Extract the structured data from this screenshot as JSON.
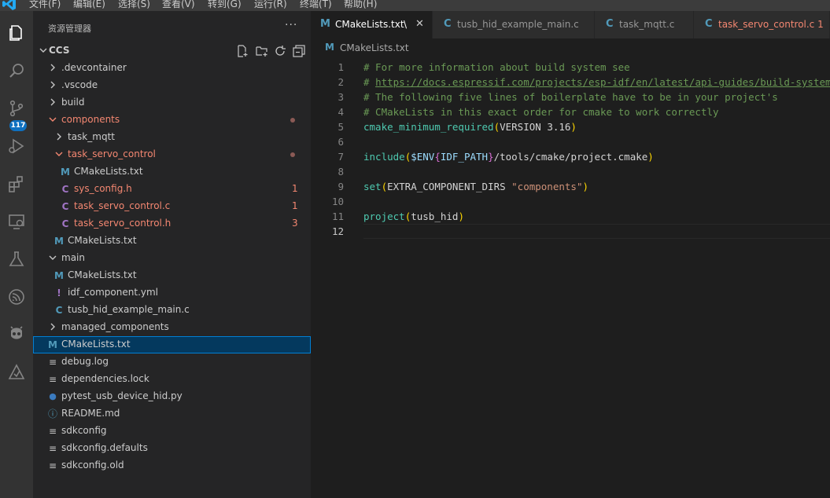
{
  "menubar": {
    "items": [
      "文件(F)",
      "编辑(E)",
      "选择(S)",
      "查看(V)",
      "转到(G)",
      "运行(R)",
      "终端(T)",
      "帮助(H)"
    ]
  },
  "activity_bar": {
    "icons": [
      "explorer-icon",
      "search-icon",
      "source-control-icon",
      "run-debug-icon",
      "extensions-icon",
      "remote-explorer-icon",
      "testing-icon",
      "espressif-icon",
      "platformio-icon",
      "idf-icon"
    ],
    "source_control_badge": "117"
  },
  "sidebar": {
    "title": "资源管理器",
    "more": "···",
    "root": "CCS",
    "tree": [
      {
        "label": "devcontainer",
        "prefix": ".",
        "type": "folder",
        "expanded": false,
        "depth": 1
      },
      {
        "label": "vscode",
        "prefix": ".",
        "type": "folder",
        "expanded": false,
        "depth": 1
      },
      {
        "label": "build",
        "type": "folder",
        "expanded": false,
        "depth": 1
      },
      {
        "label": "components",
        "type": "folder",
        "expanded": true,
        "depth": 1,
        "status": "modified"
      },
      {
        "label": "task_mqtt",
        "type": "folder",
        "expanded": false,
        "depth": 2
      },
      {
        "label": "task_servo_control",
        "type": "folder",
        "expanded": true,
        "depth": 2,
        "status": "modified"
      },
      {
        "label": "CMakeLists.txt",
        "type": "cmake",
        "depth": 3
      },
      {
        "label": "sys_config.h",
        "type": "c",
        "depth": 3,
        "problems": "1"
      },
      {
        "label": "task_servo_control.c",
        "type": "c",
        "depth": 3,
        "problems": "1"
      },
      {
        "label": "task_servo_control.h",
        "type": "c",
        "depth": 3,
        "problems": "3"
      },
      {
        "label": "CMakeLists.txt",
        "type": "cmake",
        "depth": 2
      },
      {
        "label": "main",
        "type": "folder",
        "expanded": true,
        "depth": 1
      },
      {
        "label": "CMakeLists.txt",
        "type": "cmake",
        "depth": 2
      },
      {
        "label": "idf_component.yml",
        "type": "yml",
        "depth": 2
      },
      {
        "label": "tusb_hid_example_main.c",
        "type": "c-plain",
        "depth": 2
      },
      {
        "label": "managed_components",
        "type": "folder",
        "expanded": false,
        "depth": 1
      },
      {
        "label": "CMakeLists.txt",
        "type": "cmake",
        "depth": 1,
        "selected": true
      },
      {
        "label": "debug.log",
        "type": "text",
        "depth": 1
      },
      {
        "label": "dependencies.lock",
        "type": "text",
        "depth": 1
      },
      {
        "label": "pytest_usb_device_hid.py",
        "type": "python",
        "depth": 1
      },
      {
        "label": "README.md",
        "type": "info",
        "depth": 1
      },
      {
        "label": "sdkconfig",
        "type": "text",
        "depth": 1
      },
      {
        "label": "sdkconfig.defaults",
        "type": "text",
        "depth": 1
      },
      {
        "label": "sdkconfig.old",
        "type": "text",
        "depth": 1
      }
    ]
  },
  "tabs": [
    {
      "label": "CMakeLists.txt",
      "icon": "M",
      "active": true,
      "close": "✕",
      "extra": "\\"
    },
    {
      "label": "tusb_hid_example_main.c",
      "icon": "C"
    },
    {
      "label": "task_mqtt.c",
      "icon": "C"
    },
    {
      "label": "task_servo_control.c 1",
      "icon": "C",
      "error": true
    }
  ],
  "breadcrumb": {
    "icon": "M",
    "label": "CMakeLists.txt"
  },
  "editor": {
    "current_line": 12,
    "lines": [
      [
        {
          "t": "# For more information about build system see",
          "c": "c-comment"
        }
      ],
      [
        {
          "t": "# ",
          "c": "c-comment"
        },
        {
          "t": "https://docs.espressif.com/projects/esp-idf/en/latest/api-guides/build-system.html",
          "c": "c-link"
        }
      ],
      [
        {
          "t": "# The following five lines of boilerplate have to be in your project's",
          "c": "c-comment"
        }
      ],
      [
        {
          "t": "# CMakeLists in this exact order for cmake to work correctly",
          "c": "c-comment"
        }
      ],
      [
        {
          "t": "cmake_minimum_required",
          "c": "c-func"
        },
        {
          "t": "(",
          "c": "c-paren"
        },
        {
          "t": "VERSION 3.16",
          "c": "c-plain"
        },
        {
          "t": ")",
          "c": "c-paren"
        }
      ],
      [],
      [
        {
          "t": "include",
          "c": "c-func"
        },
        {
          "t": "(",
          "c": "c-paren"
        },
        {
          "t": "$ENV",
          "c": "c-var"
        },
        {
          "t": "{",
          "c": "c-brace"
        },
        {
          "t": "IDF_PATH",
          "c": "c-var"
        },
        {
          "t": "}",
          "c": "c-brace"
        },
        {
          "t": "/tools/cmake/project.cmake",
          "c": "c-plain"
        },
        {
          "t": ")",
          "c": "c-paren"
        }
      ],
      [],
      [
        {
          "t": "set",
          "c": "c-func"
        },
        {
          "t": "(",
          "c": "c-paren"
        },
        {
          "t": "EXTRA_COMPONENT_DIRS ",
          "c": "c-plain"
        },
        {
          "t": "\"components\"",
          "c": "c-str"
        },
        {
          "t": ")",
          "c": "c-paren"
        }
      ],
      [],
      [
        {
          "t": "project",
          "c": "c-func"
        },
        {
          "t": "(",
          "c": "c-paren"
        },
        {
          "t": "tusb_hid",
          "c": "c-plain"
        },
        {
          "t": ")",
          "c": "c-paren"
        }
      ],
      []
    ]
  },
  "colors": {
    "accent": "#007fd4",
    "error": "#f48771",
    "cmake_icon": "#519aba",
    "c_icon": "#a074c4",
    "comment": "#6a9955"
  }
}
